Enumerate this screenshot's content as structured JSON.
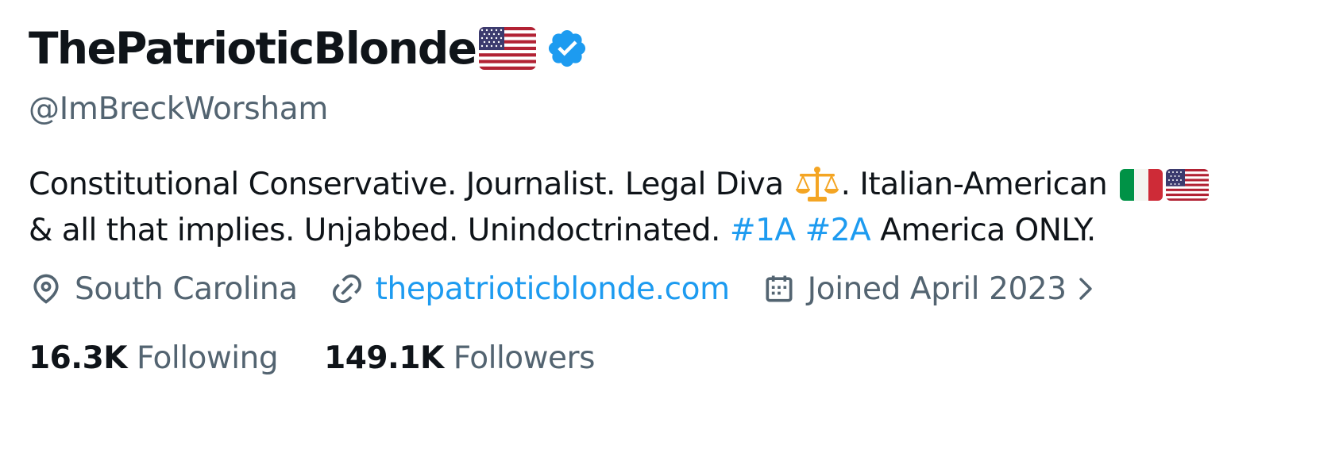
{
  "profile": {
    "display_name": "ThePatrioticBlonde",
    "name_flag_icon": "us-flag-icon",
    "verified_icon": "verified-badge-icon",
    "verified_color": "#1d9bf0",
    "handle": "@ImBreckWorsham",
    "bio": {
      "line1_text": "Constitutional Conservative. Journalist. Legal Diva",
      "line1_scale_icon": "balance-scale-icon",
      "line1_after_scale": ". Italian-American",
      "line1_flags": [
        "italy-flag-icon",
        "us-flag-icon"
      ],
      "line2_text": "& all that implies. Unjabbed. Unindoctrinated.",
      "hashtags": [
        "#1A",
        "#2A"
      ],
      "line2_end": "America ONLY."
    },
    "meta": {
      "location_icon": "location-pin-icon",
      "location": "South Carolina",
      "link_icon": "link-icon",
      "website": "thepatrioticblonde.com",
      "calendar_icon": "calendar-icon",
      "joined": "Joined April 2023",
      "chevron_icon": "chevron-right-icon"
    },
    "stats": {
      "following_count": "16.3K",
      "following_label": "Following",
      "followers_count": "149.1K",
      "followers_label": "Followers"
    }
  },
  "colors": {
    "text_primary": "#0f1419",
    "text_secondary": "#536471",
    "accent": "#1d9bf0"
  }
}
